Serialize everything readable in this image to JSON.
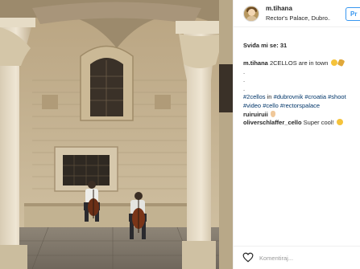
{
  "post": {
    "username": "m.tihana",
    "location": "Rector's Palace, Dubro...",
    "follow_label": "Pr",
    "likes_text": "Sviđa mi se: 31",
    "caption": {
      "author": "m.tihana",
      "text": "2CELLOS are in town",
      "dot1": ".",
      "dot2": ".",
      "dot3": ".",
      "tags_line1": [
        "#2cellos",
        "in",
        "#dubrovnik",
        "#croatia",
        "#shoot"
      ],
      "tags_line2": [
        "#video",
        "#cello",
        "#rectorspalace"
      ]
    },
    "comments": [
      {
        "author": "ruiruiruii",
        "text": ""
      },
      {
        "author": "oliverschlaffer_cello",
        "text": "Super cool!"
      }
    ],
    "comment_placeholder": "Komentiraj...",
    "icons": {
      "heart": "heart-outline-icon",
      "emoji_smile": "smiling-face-icon",
      "emoji_sax": "saxophone-icon",
      "emoji_clap": "clapping-hands-icon"
    },
    "colors": {
      "link_blue": "#3897f0",
      "hashtag": "#003569",
      "text": "#262626",
      "muted": "#999999"
    }
  }
}
